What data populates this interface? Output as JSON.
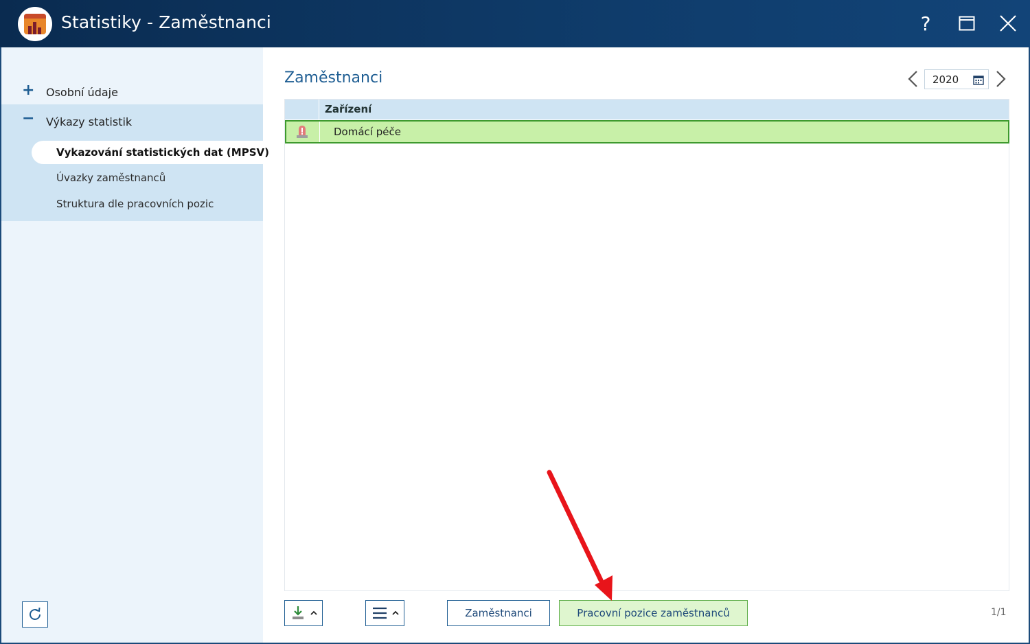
{
  "window": {
    "title": "Statistiky - Zaměstnanci",
    "help_label": "?"
  },
  "sidebar": {
    "items": [
      {
        "sign": "+",
        "label": "Osobní údaje"
      },
      {
        "sign": "−",
        "label": "Výkazy statistik"
      }
    ],
    "subitems": [
      {
        "label": "Vykazování statistických dat (MPSV)",
        "active": true
      },
      {
        "label": "Úvazky zaměstnanců",
        "active": false
      },
      {
        "label": "Struktura dle pracovních pozic",
        "active": false
      }
    ]
  },
  "main": {
    "title": "Zaměstnanci",
    "year": "2020",
    "table": {
      "columns": [
        "Zařízení"
      ],
      "rows": [
        {
          "icon": "alarm-icon",
          "name": "Domácí péče"
        }
      ]
    },
    "toolbar": {
      "employees_label": "Zaměstnanci",
      "positions_label": "Pracovní pozice zaměstnanců",
      "pager": "1/1"
    }
  },
  "colors": {
    "titlebar": "#0f3c6b",
    "accent": "#1f5e93",
    "selected_row": "#c8f0a8",
    "annotation_arrow": "#e8141a"
  }
}
